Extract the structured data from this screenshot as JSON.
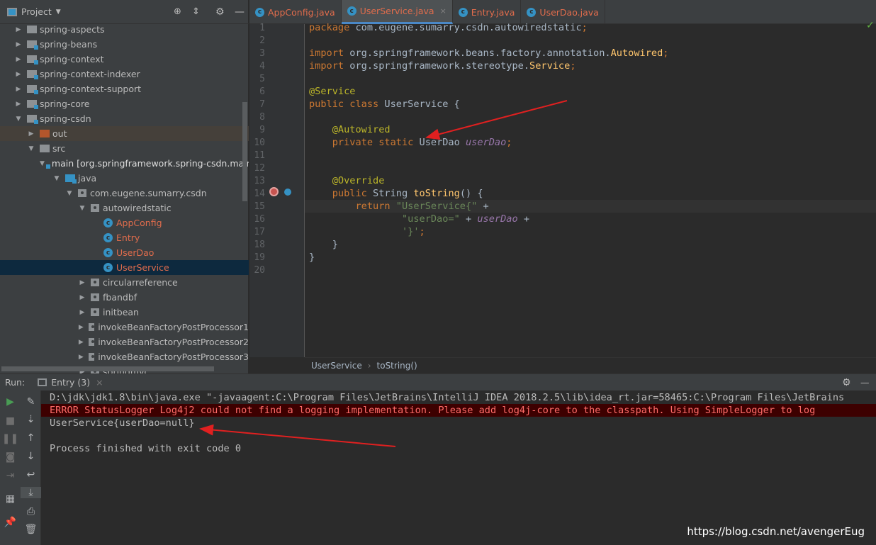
{
  "sidebar": {
    "title": "Project",
    "tree": [
      {
        "label": "spring-aspects",
        "level": 1,
        "type": "folder",
        "open": false
      },
      {
        "label": "spring-beans",
        "level": 1,
        "type": "module",
        "open": false
      },
      {
        "label": "spring-context",
        "level": 1,
        "type": "module",
        "open": false
      },
      {
        "label": "spring-context-indexer",
        "level": 1,
        "type": "module",
        "open": false
      },
      {
        "label": "spring-context-support",
        "level": 1,
        "type": "module",
        "open": false
      },
      {
        "label": "spring-core",
        "level": 1,
        "type": "module",
        "open": false
      },
      {
        "label": "spring-csdn",
        "level": 1,
        "type": "module",
        "open": true
      },
      {
        "label": "out",
        "level": 2,
        "type": "out",
        "open": false,
        "highlight": true
      },
      {
        "label": "src",
        "level": 2,
        "type": "folder",
        "open": true
      },
      {
        "label": "main [org.springframework.spring-csdn.main]",
        "level": 3,
        "type": "module",
        "open": true
      },
      {
        "label": "java",
        "level": 4,
        "type": "src",
        "open": true
      },
      {
        "label": "com.eugene.sumarry.csdn",
        "level": 5,
        "type": "package",
        "open": true
      },
      {
        "label": "autowiredstatic",
        "level": 6,
        "type": "package",
        "open": true
      },
      {
        "label": "AppConfig",
        "level": 7,
        "type": "class"
      },
      {
        "label": "Entry",
        "level": 7,
        "type": "class"
      },
      {
        "label": "UserDao",
        "level": 7,
        "type": "class"
      },
      {
        "label": "UserService",
        "level": 7,
        "type": "class",
        "selected": true
      },
      {
        "label": "circularreference",
        "level": 6,
        "type": "package",
        "open": false
      },
      {
        "label": "fbandbf",
        "level": 6,
        "type": "package",
        "open": false
      },
      {
        "label": "initbean",
        "level": 6,
        "type": "package",
        "open": false
      },
      {
        "label": "invokeBeanFactoryPostProcessor1",
        "level": 6,
        "type": "package",
        "open": false
      },
      {
        "label": "invokeBeanFactoryPostProcessor2",
        "level": 6,
        "type": "package",
        "open": false
      },
      {
        "label": "invokeBeanFactoryPostProcessor3",
        "level": 6,
        "type": "package",
        "open": false
      },
      {
        "label": "springmvc",
        "level": 6,
        "type": "package",
        "open": false
      }
    ]
  },
  "tabs": [
    {
      "label": "AppConfig.java"
    },
    {
      "label": "UserService.java",
      "active": true
    },
    {
      "label": "Entry.java"
    },
    {
      "label": "UserDao.java"
    }
  ],
  "editor": {
    "lines": [
      [
        [
          "package",
          "kw"
        ],
        [
          " com.eugene.sumarry.csdn.autowiredstatic",
          ""
        ],
        [
          ";",
          "kw"
        ]
      ],
      [],
      [
        [
          "import",
          "kw"
        ],
        [
          " org.springframework.beans.factory.annotation.",
          ""
        ],
        [
          "Autowired",
          "fn"
        ],
        [
          ";",
          "kw"
        ]
      ],
      [
        [
          "import",
          "kw"
        ],
        [
          " org.springframework.stereotype.",
          ""
        ],
        [
          "Service",
          "fn"
        ],
        [
          ";",
          "kw"
        ]
      ],
      [],
      [
        [
          "@Service",
          "ann"
        ]
      ],
      [
        [
          "public class ",
          "kw"
        ],
        [
          "UserService {",
          ""
        ]
      ],
      [],
      [
        [
          "    ",
          ""
        ],
        [
          "@Autowired",
          "ann"
        ]
      ],
      [
        [
          "    ",
          ""
        ],
        [
          "private static ",
          "kw"
        ],
        [
          "UserDao ",
          ""
        ],
        [
          "userDao",
          "fld"
        ],
        [
          ";",
          "kw"
        ]
      ],
      [],
      [],
      [
        [
          "    ",
          ""
        ],
        [
          "@Override",
          "ann"
        ]
      ],
      [
        [
          "    ",
          ""
        ],
        [
          "public ",
          "kw"
        ],
        [
          "String ",
          ""
        ],
        [
          "toString",
          "fn"
        ],
        [
          "() {",
          ""
        ]
      ],
      [
        [
          "        ",
          ""
        ],
        [
          "return ",
          "kw"
        ],
        [
          "\"UserService{\"",
          "str"
        ],
        [
          " +",
          ""
        ]
      ],
      [
        [
          "                ",
          ""
        ],
        [
          "\"userDao=\"",
          "str"
        ],
        [
          " + ",
          ""
        ],
        [
          "userDao",
          "fld"
        ],
        [
          " +",
          ""
        ]
      ],
      [
        [
          "                ",
          ""
        ],
        [
          "'}'",
          "str"
        ],
        [
          ";",
          "kw"
        ]
      ],
      [
        [
          "    }",
          ""
        ]
      ],
      [
        [
          "}",
          ""
        ]
      ],
      []
    ]
  },
  "breadcrumb": [
    "UserService",
    "toString()"
  ],
  "run": {
    "label": "Run:",
    "tab": "Entry (3)",
    "console": [
      {
        "text": "D:\\jdk\\jdk1.8\\bin\\java.exe \"-javaagent:C:\\Program Files\\JetBrains\\IntelliJ IDEA 2018.2.5\\lib\\idea_rt.jar=58465:C:\\Program Files\\JetBrains",
        "type": "normal"
      },
      {
        "text": "ERROR StatusLogger Log4j2 could not find a logging implementation. Please add log4j-core to the classpath. Using SimpleLogger to log",
        "type": "error"
      },
      {
        "text": "UserService{userDao=null}",
        "type": "normal"
      },
      {
        "text": "",
        "type": "normal"
      },
      {
        "text": "Process finished with exit code 0",
        "type": "normal"
      }
    ]
  },
  "watermark": "https://blog.csdn.net/avengerEug",
  "colors": {
    "keyword": "#cc7832",
    "string": "#6a8759",
    "annotation": "#bbb529",
    "field": "#9876aa",
    "error": "#ff6b68",
    "arrow": "#e02020"
  }
}
